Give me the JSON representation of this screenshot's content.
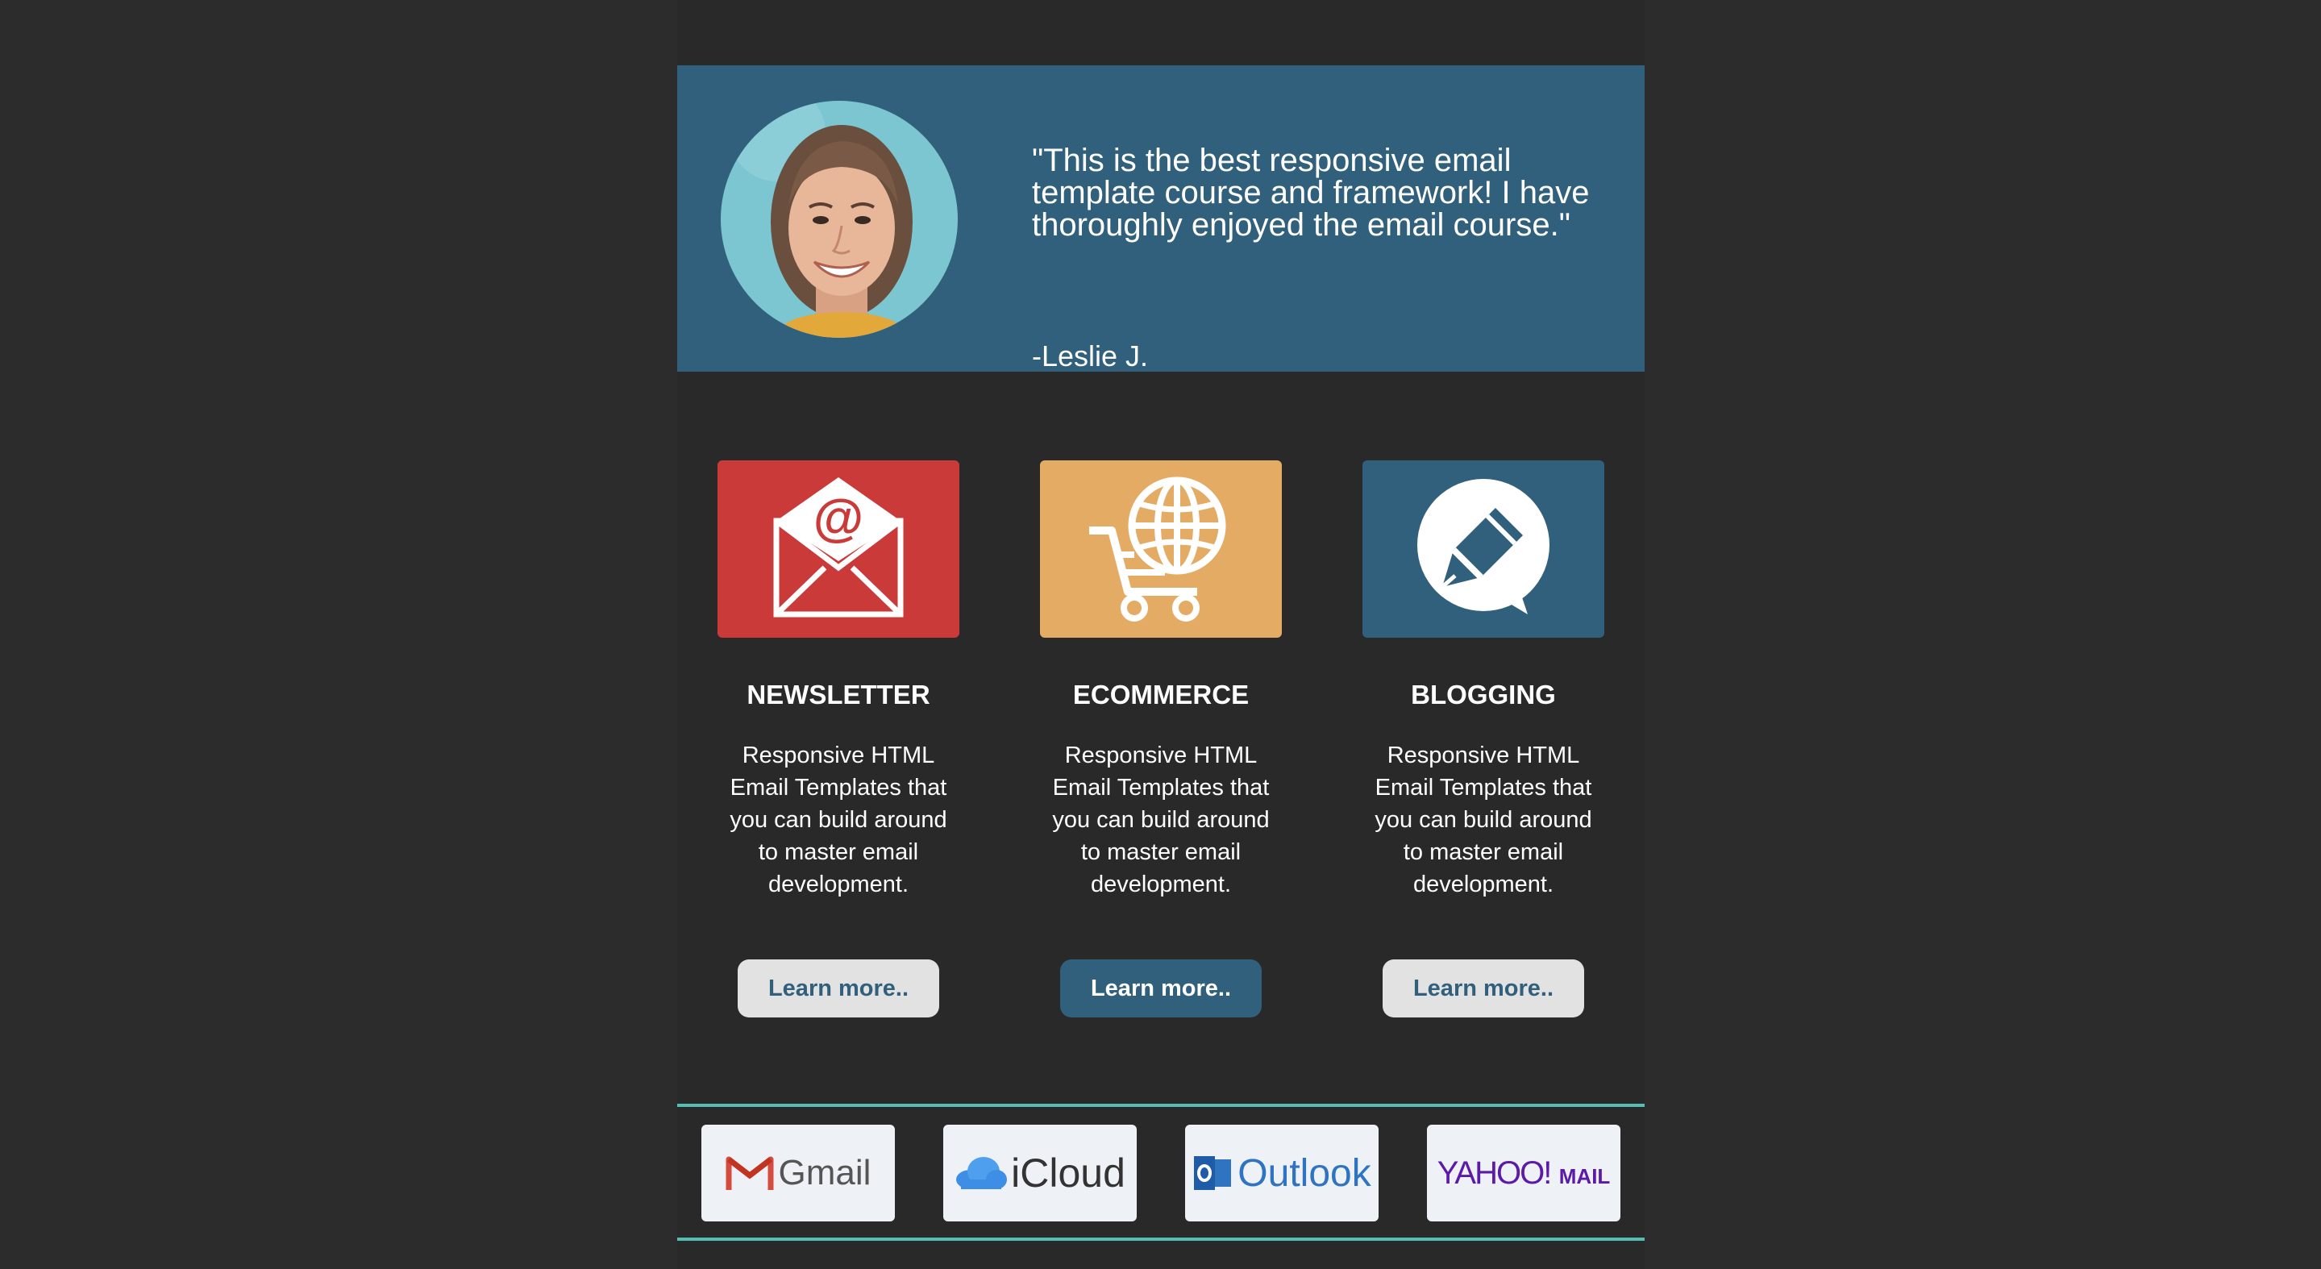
{
  "testimonial": {
    "quote": "\"This is the best responsive email template course and framework! I have thoroughly enjoyed the email course.\"",
    "author": "-Leslie J."
  },
  "features": [
    {
      "title": "NEWSLETTER",
      "description": "Responsive HTML Email Templates that you can build around to master email development.",
      "button": "Learn more..",
      "color": "#c93a38",
      "icon": "envelope-icon"
    },
    {
      "title": "ECOMMERCE",
      "description": "Responsive HTML Email Templates that you can build around to master email development.",
      "button": "Learn more..",
      "color": "#e3ab63",
      "icon": "cart-globe-icon"
    },
    {
      "title": "BLOGGING",
      "description": "Responsive HTML Email Templates that you can build around to master email development.",
      "button": "Learn more..",
      "color": "#31607c",
      "icon": "blog-bubble-icon"
    }
  ],
  "clients": [
    {
      "label": "Gmail",
      "icon": "gmail-icon"
    },
    {
      "label": "iCloud",
      "icon": "icloud-icon"
    },
    {
      "label": "Outlook",
      "icon": "outlook-icon"
    },
    {
      "label": "YAHOO! MAIL",
      "prefix": "YAHOO!",
      "suffix": "MAIL",
      "icon": "yahoo-mail-icon"
    }
  ],
  "colors": {
    "background": "#2c2c2c",
    "testimonial_bg": "#31607c",
    "accent_line": "#56bdb5",
    "button_light": "#e2e2e2",
    "button_dark": "#31607c"
  }
}
